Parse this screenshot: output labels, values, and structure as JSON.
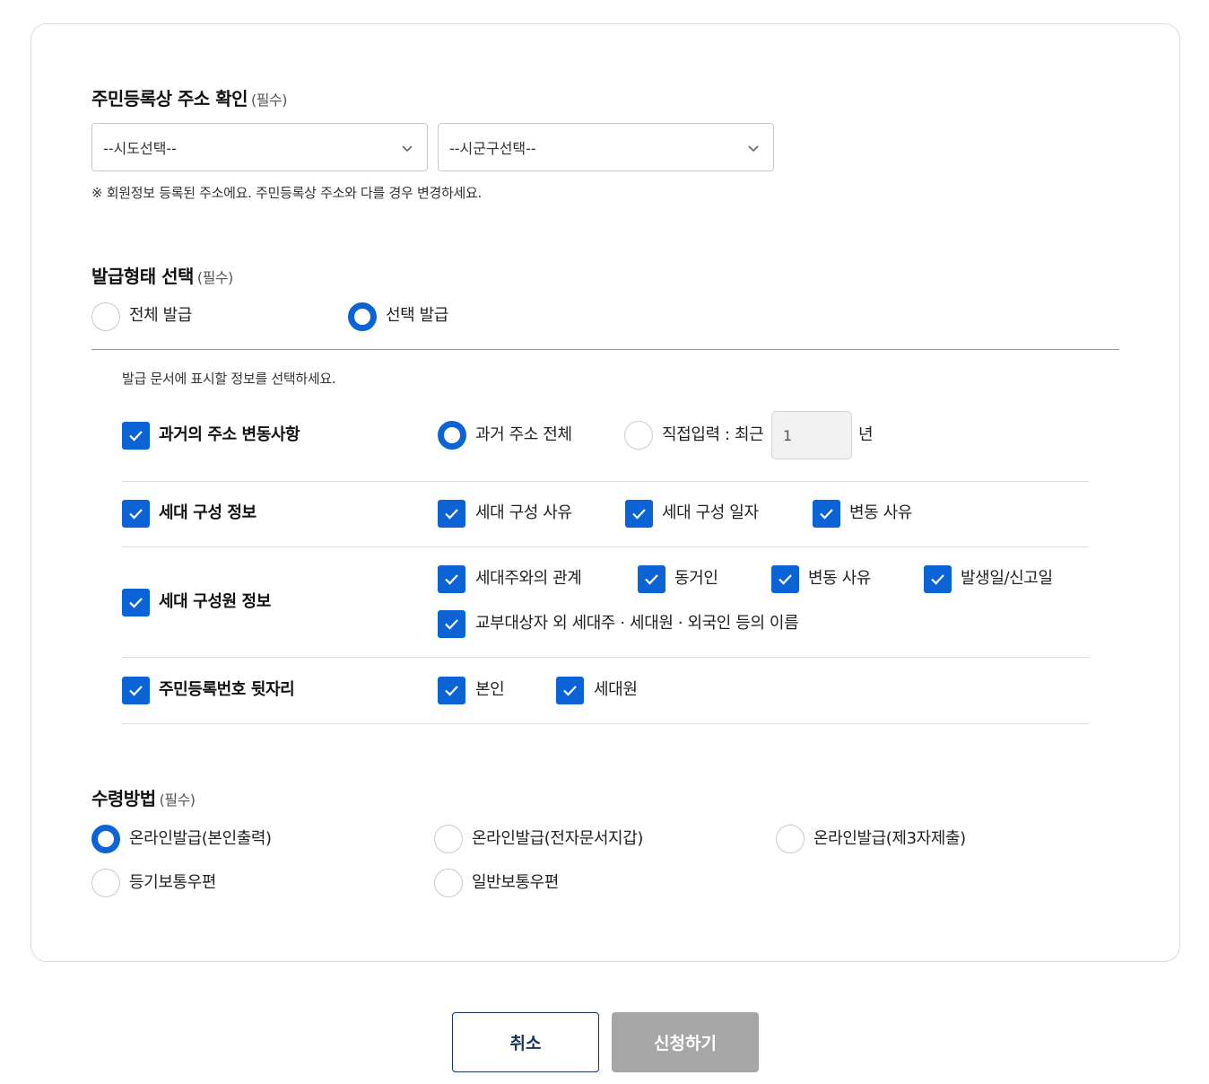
{
  "address_section": {
    "title": "주민등록상 주소 확인",
    "required": "(필수)",
    "sido_select": "--시도선택--",
    "sigungu_select": "--시군구선택--",
    "note": "※ 회원정보 등록된 주소에요. 주민등록상 주소와 다를 경우 변경하세요."
  },
  "issue_type_section": {
    "title": "발급형태 선택",
    "required": "(필수)",
    "options": [
      {
        "label": "전체 발급",
        "selected": false
      },
      {
        "label": "선택 발급",
        "selected": true
      }
    ],
    "instruction": "발급 문서에 표시할 정보를 선택하세요.",
    "rows": {
      "past_address": {
        "label": "과거의 주소 변동사항",
        "checked": true,
        "opt_all": "과거 주소 전체",
        "opt_all_selected": true,
        "opt_direct": "직접입력 : 최근",
        "opt_direct_selected": false,
        "years_value": "1",
        "years_unit": "년"
      },
      "household": {
        "label": "세대 구성 정보",
        "checked": true,
        "items": [
          {
            "label": "세대 구성 사유",
            "checked": true
          },
          {
            "label": "세대 구성 일자",
            "checked": true
          },
          {
            "label": "변동 사유",
            "checked": true
          }
        ]
      },
      "members": {
        "label": "세대 구성원 정보",
        "checked": true,
        "items": [
          {
            "label": "세대주와의 관계",
            "checked": true
          },
          {
            "label": "동거인",
            "checked": true
          },
          {
            "label": "변동 사유",
            "checked": true
          },
          {
            "label": "발생일/신고일",
            "checked": true
          },
          {
            "label": "교부대상자 외 세대주 · 세대원 · 외국인 등의 이름",
            "checked": true
          }
        ]
      },
      "rrn_suffix": {
        "label": "주민등록번호 뒷자리",
        "checked": true,
        "items": [
          {
            "label": "본인",
            "checked": true
          },
          {
            "label": "세대원",
            "checked": true
          }
        ]
      }
    }
  },
  "receive_section": {
    "title": "수령방법",
    "required": "(필수)",
    "options": [
      {
        "label": "온라인발급(본인출력)",
        "selected": true
      },
      {
        "label": "온라인발급(전자문서지갑)",
        "selected": false
      },
      {
        "label": "온라인발급(제3자제출)",
        "selected": false
      },
      {
        "label": "등기보통우편",
        "selected": false
      },
      {
        "label": "일반보통우편",
        "selected": false
      }
    ]
  },
  "buttons": {
    "cancel": "취소",
    "submit": "신청하기"
  },
  "colors": {
    "accent": "#0b63d6",
    "cancel_border": "#17345e",
    "submit_disabled": "#a6a6a6"
  }
}
